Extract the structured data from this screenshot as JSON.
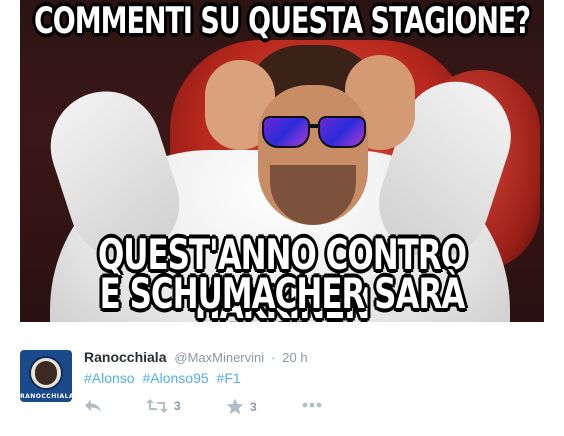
{
  "meme": {
    "top_text": "COMMENTI SU QUESTA STAGIONE?",
    "bottom_line1": "QUEST'ANNO CONTRO HAKKINEN",
    "bottom_line2": "E SCHUMACHER SARÀ DURISSIMA"
  },
  "tweet": {
    "display_name": "Ranocchiala",
    "handle": "@MaxMinervini",
    "separator": "·",
    "time": "20 h",
    "hashtags": [
      "#Alonso",
      "#Alonso95",
      "#F1"
    ],
    "avatar_label": "RANOCCHIALA",
    "actions": {
      "reply_icon": "reply-icon",
      "retweet_icon": "retweet-icon",
      "retweet_count": "3",
      "favorite_icon": "star-icon",
      "favorite_count": "3",
      "more_icon": "more-dots-icon"
    },
    "colors": {
      "link": "#55acee",
      "muted": "#8899a6",
      "name": "#292f33"
    }
  }
}
